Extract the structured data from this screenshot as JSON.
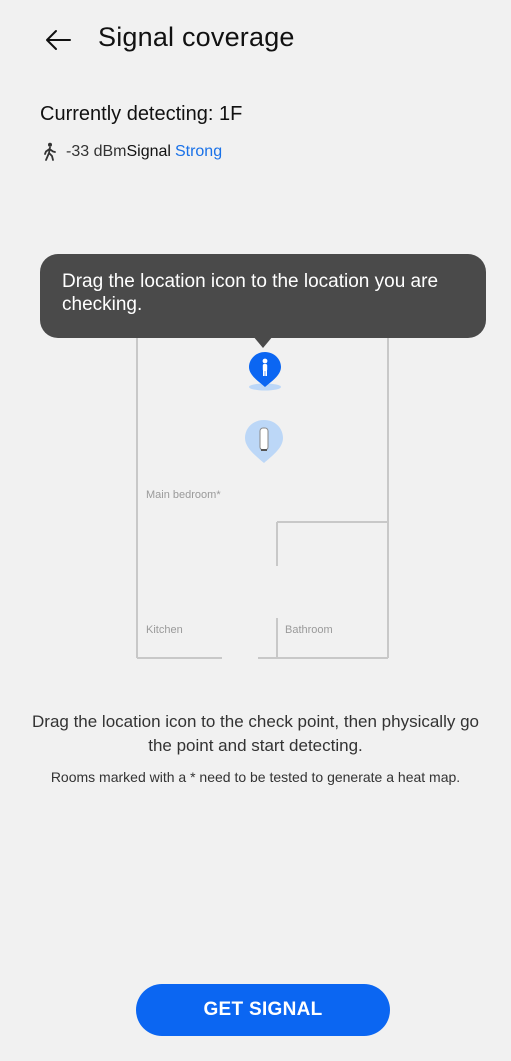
{
  "header": {
    "title": "Signal coverage",
    "back_icon": "arrow-left-icon"
  },
  "status": {
    "detecting": "Currently detecting: 1F",
    "walker_icon": "walking-person-icon",
    "dbm": "-33 dBm",
    "signal_label": "Signal",
    "signal_strength": "Strong",
    "strength_color": "#1971e8"
  },
  "tooltip": {
    "text": "Drag the location icon to the location you are checking."
  },
  "floorplan": {
    "rooms": {
      "main_bedroom": "Main bedroom*",
      "kitchen": "Kitchen",
      "bathroom": "Bathroom"
    },
    "location_pin_icon": "person-location-pin-icon",
    "router_pin_icon": "router-pin-icon"
  },
  "instructions": {
    "main": "Drag the location icon to the check point, then physically go the point and start detecting.",
    "note": "Rooms marked with a * need to be tested to generate a heat map."
  },
  "actions": {
    "get_signal": "GET SIGNAL",
    "button_color": "#0b66f2"
  }
}
